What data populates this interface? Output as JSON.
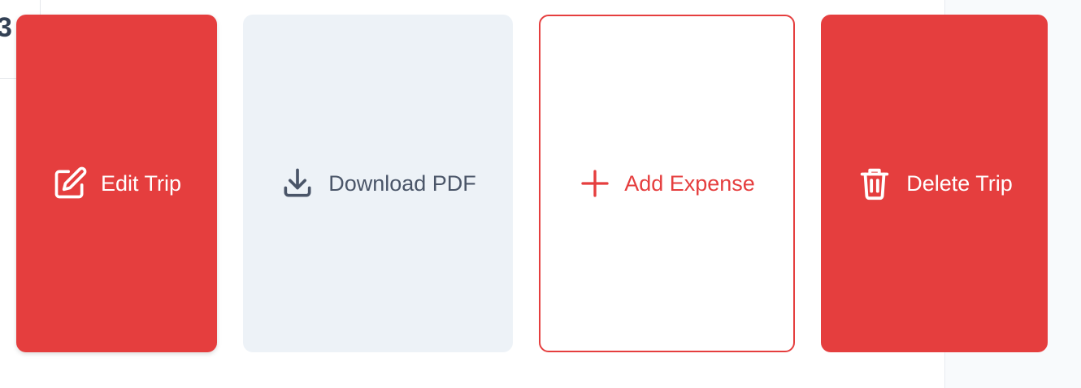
{
  "left_fragment": {
    "text": "3"
  },
  "actions": {
    "edit": {
      "label": "Edit Trip",
      "icon": "edit-icon",
      "color": "#e53e3e"
    },
    "download": {
      "label": "Download PDF",
      "icon": "download-icon",
      "color": "#edf2f7"
    },
    "add": {
      "label": "Add Expense",
      "icon": "plus-icon",
      "color": "#e53e3e"
    },
    "delete": {
      "label": "Delete Trip",
      "icon": "trash-icon",
      "color": "#e53e3e"
    }
  }
}
